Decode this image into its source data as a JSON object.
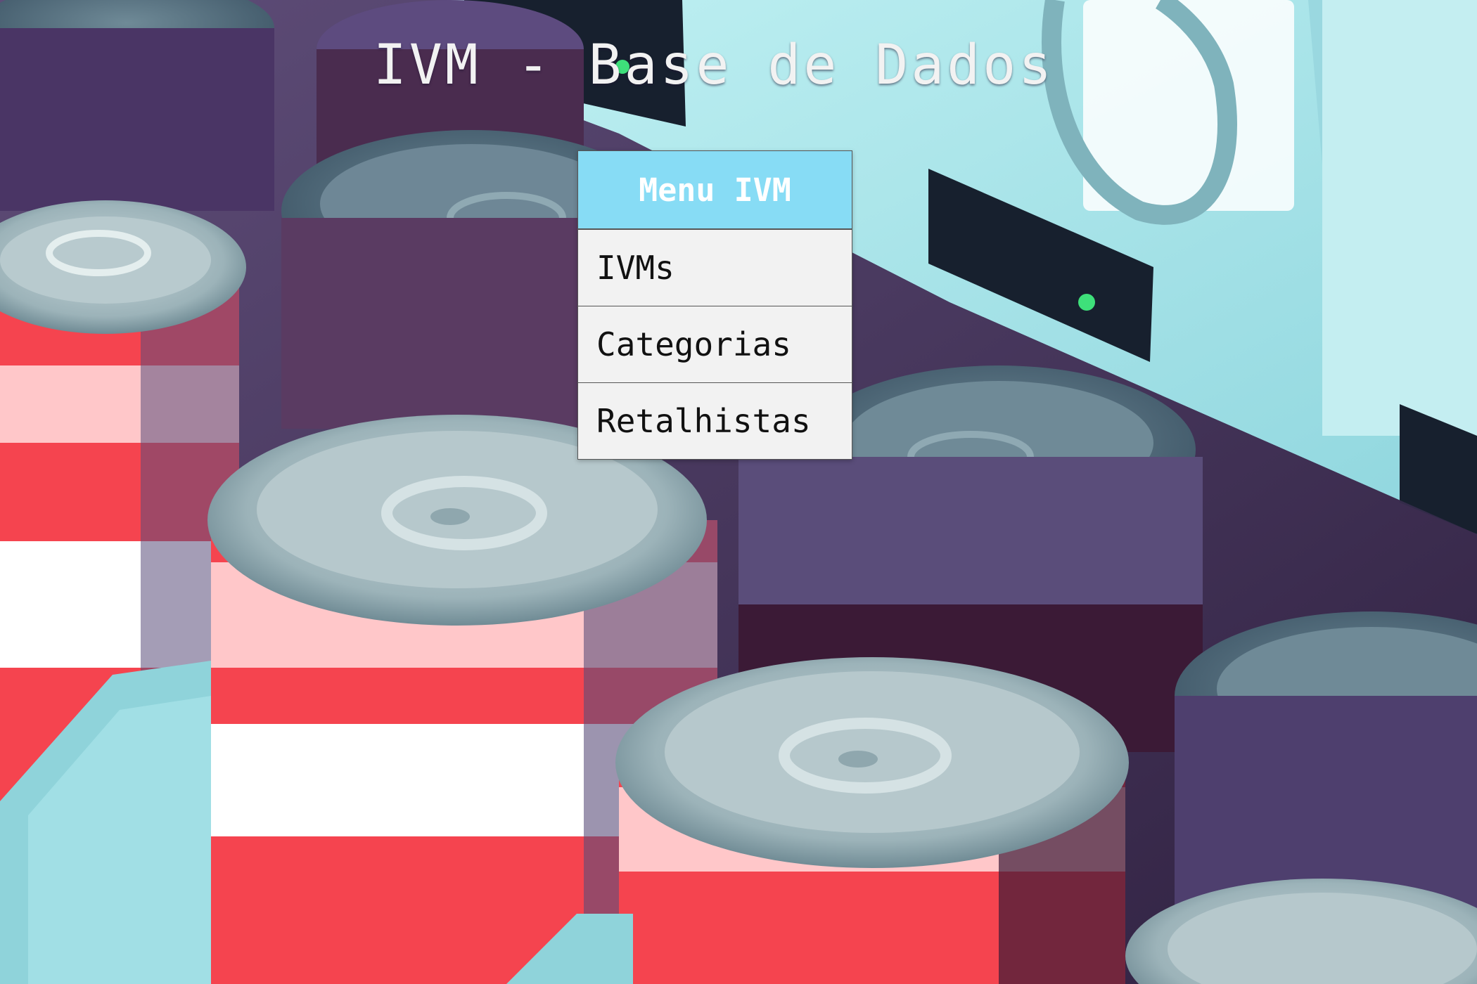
{
  "page": {
    "title": "IVM - Base de Dados"
  },
  "menu": {
    "header": "Menu IVM",
    "items": [
      {
        "label": "IVMs"
      },
      {
        "label": "Categorias"
      },
      {
        "label": "Retalhistas"
      }
    ]
  },
  "background": {
    "subject": "vending machine soda cans illustration",
    "colors": {
      "can_red": "#f5444f",
      "can_pink": "#ffc7c9",
      "can_lid": "#8fa7ae",
      "shadow_purple": "#5a4d7a",
      "dark_maroon": "#3b1a36",
      "machine_cyan": "#a8e4ea",
      "panel_dark": "#17202e",
      "indicator_green": "#3ee07a"
    }
  },
  "theme": {
    "menu_header_bg": "#87dcf5",
    "menu_item_bg": "#f2f2f2",
    "title_color": "#f2f2f2"
  }
}
